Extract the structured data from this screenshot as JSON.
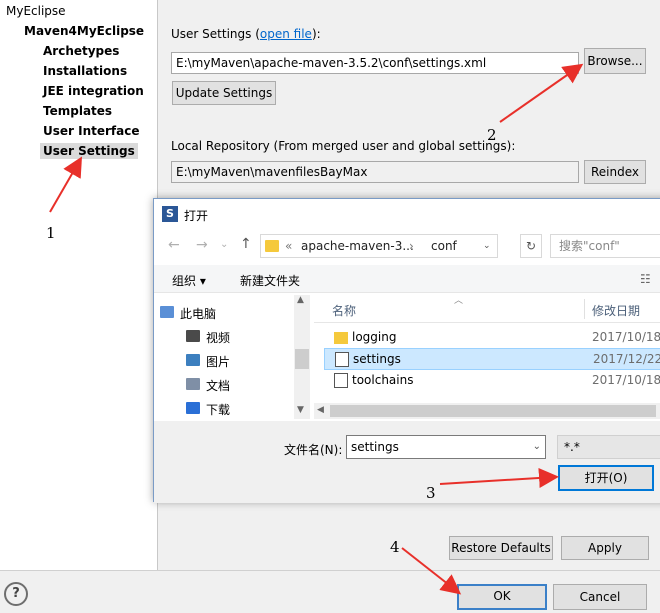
{
  "tree": {
    "root": "MyEclipse",
    "parent": "Maven4MyEclipse",
    "children": [
      "Archetypes",
      "Installations",
      "JEE integration",
      "Templates",
      "User Interface",
      "User Settings"
    ]
  },
  "user_settings": {
    "label_prefix": "User Settings (",
    "open_file_link": "open file",
    "label_suffix": "):",
    "path_value": "E:\\myMaven\\apache-maven-3.5.2\\conf\\settings.xml",
    "browse_label": "Browse...",
    "update_label": "Update Settings",
    "local_repo_label": "Local Repository (From merged user and global settings):",
    "local_repo_value": "E:\\myMaven\\mavenfilesBayMax",
    "reindex_label": "Reindex"
  },
  "footer": {
    "help_icon": "?",
    "restore_defaults_label": "Restore Defaults",
    "apply_label": "Apply",
    "ok_label": "OK",
    "cancel_label": "Cancel"
  },
  "dialog": {
    "title": "打开",
    "app_icon": "S",
    "breadcrumb": [
      "«",
      "apache-maven-3...",
      "›",
      "conf"
    ],
    "search_placeholder": "搜索\"conf\"",
    "organize_label": "组织 ▾",
    "new_folder_label": "新建文件夹",
    "view_icon": "☷",
    "nav_items": [
      {
        "label": "此电脑",
        "icon": "computer-icon",
        "color": "#5a8fd6"
      },
      {
        "label": "视频",
        "icon": "video-icon",
        "color": "#4a4a4a"
      },
      {
        "label": "图片",
        "icon": "picture-icon",
        "color": "#3c7fbf"
      },
      {
        "label": "文档",
        "icon": "document-icon",
        "color": "#7f8fa6"
      },
      {
        "label": "下载",
        "icon": "download-icon",
        "color": "#2a6fd6"
      }
    ],
    "columns": {
      "name": "名称",
      "date": "修改日期"
    },
    "files": [
      {
        "name": "logging",
        "date": "2017/10/18,",
        "type": "folder",
        "selected": false
      },
      {
        "name": "settings",
        "date": "2017/12/22,",
        "type": "xml",
        "selected": true
      },
      {
        "name": "toolchains",
        "date": "2017/10/18,",
        "type": "xml",
        "selected": false
      }
    ],
    "filename_label": "文件名(N):",
    "filename_value": "settings",
    "filetype_value": "*.*",
    "open_button_label": "打开(O)"
  },
  "annotations": [
    "1",
    "2",
    "3",
    "4"
  ],
  "colors": {
    "arrow": "#e8302a",
    "link": "#0066cc",
    "selection": "#cce8ff"
  }
}
